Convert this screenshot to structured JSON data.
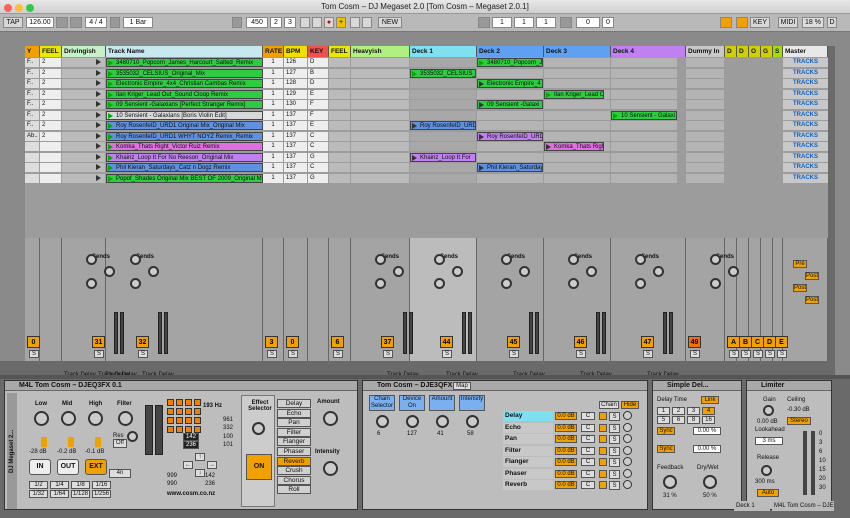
{
  "window": {
    "title": "Tom Cosm – DJ Megaset 2.0  [Tom Cosm – Megaset 2.0.1]"
  },
  "transport": {
    "tap": "TAP",
    "tempo": "126.00",
    "sig": "4 / 4",
    "quant": "1 Bar",
    "pos": "450",
    "pos_b": "2",
    "pos_c": "3",
    "new": "NEW",
    "loop_a": "1",
    "loop_b": "1",
    "loop_c": "1",
    "loop_d": "0",
    "loop_e": "0",
    "key": "KEY",
    "midi": "MIDI",
    "cpu": "18 %",
    "d_label": "D"
  },
  "colors": {
    "accent": "#f0a000",
    "green": "#2ecc40",
    "cyan": "#7ee0f0",
    "purple": "#c080f0",
    "blue": "#6090e0"
  },
  "tracks": [
    {
      "name": "Y",
      "bg": "#f0a000"
    },
    {
      "name": "FEEL",
      "bg": "#e8e800"
    },
    {
      "name": "Drivingish",
      "bg": "#c8f0c8"
    },
    {
      "name": "Track Name",
      "bg": "#c8e8f0"
    },
    {
      "name": "RATE",
      "bg": "#f0a000"
    },
    {
      "name": "BPM",
      "bg": "#f0e000"
    },
    {
      "name": "KEY",
      "bg": "#f05050"
    },
    {
      "name": "FEEL",
      "bg": "#e8e800"
    },
    {
      "name": "Heavyish",
      "bg": "#b0f080"
    },
    {
      "name": "Deck 1",
      "bg": "#7ee0f0"
    },
    {
      "name": "Deck 2",
      "bg": "#60a0f0"
    },
    {
      "name": "Deck 3",
      "bg": "#60a0f0"
    },
    {
      "name": "Deck 4",
      "bg": "#c080f0"
    },
    {
      "name": "Dummy In",
      "bg": "#c8c8c8"
    },
    {
      "name": "D",
      "bg": "#d0d000"
    },
    {
      "name": "D",
      "bg": "#d0d000"
    },
    {
      "name": "O",
      "bg": "#d0d000"
    },
    {
      "name": "G",
      "bg": "#d0d000"
    },
    {
      "name": "S",
      "bg": "#a0e000"
    },
    {
      "name": "Master",
      "bg": "#e8e8e8"
    }
  ],
  "rows": [
    {
      "l": "F..",
      "n": "2",
      "name": "3480710_Popcorn_James_Harcourt_Salted_Remix",
      "c": "#2ecc40",
      "r": "1",
      "b": "126",
      "k": "D"
    },
    {
      "l": "F..",
      "n": "2",
      "name": "3535032_CELSIUS_Original_Mix",
      "c": "#2ecc40",
      "r": "1",
      "b": "127",
      "k": "B"
    },
    {
      "l": "F..",
      "n": "2",
      "name": "Electronic Empire_4x4_Christian Cambas Remix",
      "c": "#2ecc40",
      "r": "1",
      "b": "128",
      "k": "D"
    },
    {
      "l": "F..",
      "n": "2",
      "name": "Ilan Kriger_Lead Out_Sound Cloop Remix",
      "c": "#2ecc40",
      "r": "1",
      "b": "129",
      "k": "E"
    },
    {
      "l": "F..",
      "n": "2",
      "name": "09 Sensient -Galaxians [Perfect Stranger Remix]",
      "c": "#2ecc40",
      "r": "1",
      "b": "130",
      "k": "F"
    },
    {
      "l": "F..",
      "n": "2",
      "name": "10 Sensient - Galaxians [Boris Violin Edit]",
      "c": "#d8d8d8",
      "r": "1",
      "b": "137",
      "k": "F"
    },
    {
      "l": "F..",
      "n": "2",
      "name": "Roy RosenfeID_URD1 Original Mix_Original Mix",
      "c": "#6090e0",
      "r": "1",
      "b": "137",
      "k": "E"
    },
    {
      "l": "Ab..",
      "n": "2",
      "name": "Roy RosenfeID_URD1 WHYT NOYZ Remix_Remix",
      "c": "#6090e0",
      "r": "1",
      "b": "137",
      "k": "C"
    },
    {
      "l": "",
      "n": "",
      "name": "Komka_Thats Right_Victor Ruiz Remix",
      "c": "#e070e0",
      "r": "1",
      "b": "137",
      "k": "C"
    },
    {
      "l": "",
      "n": "",
      "name": "Khainz_Loop It For No Reeson_Original Mix",
      "c": "#c080f0",
      "r": "1",
      "b": "137",
      "k": "G"
    },
    {
      "l": "",
      "n": "",
      "name": "Phil Kieran_Saturdays_Catz n Dogz Remix",
      "c": "#6090e0",
      "r": "1",
      "b": "137",
      "k": "C"
    },
    {
      "l": "",
      "n": "",
      "name": "Popof_Shades Original Mix BEST OF 2009_Original M",
      "c": "#2ecc40",
      "r": "1",
      "b": "137",
      "k": "G"
    }
  ],
  "decks": {
    "d1": [
      {
        "row": 1,
        "t": "3535032_CELSIUS_",
        "c": "#2ecc40",
        "p": true
      },
      {
        "row": 6,
        "t": "Roy RosenfeID_URD",
        "c": "#6090e0"
      },
      {
        "row": 9,
        "t": "Khainz_Loop It For",
        "c": "#c080f0"
      }
    ],
    "d2": [
      {
        "row": 0,
        "t": "3480710_Popcorn_J",
        "c": "#2ecc40",
        "p": true
      },
      {
        "row": 2,
        "t": "Electronic Empire_4",
        "c": "#2ecc40"
      },
      {
        "row": 4,
        "t": "09 Sensient -Galaxi",
        "c": "#2ecc40"
      },
      {
        "row": 7,
        "t": "Roy RosenfeID_URD",
        "c": "#c080f0"
      },
      {
        "row": 10,
        "t": "Phil Kieran_Saturday",
        "c": "#6090e0"
      }
    ],
    "d3": [
      {
        "row": 3,
        "t": "Ilan Kriger_Lead Out",
        "c": "#2ecc40",
        "p": true
      },
      {
        "row": 8,
        "t": "Komka_Thats Right",
        "c": "#e070e0"
      }
    ],
    "d4": [
      {
        "row": 5,
        "t": "10 Sensient - Galaxi",
        "c": "#2ecc40",
        "p": true
      }
    ]
  },
  "master_label": "TRACKS",
  "mixer": {
    "sends": "Sends",
    "track_delay": "Track Delay",
    "ms": "ms",
    "delay_val": "0.00",
    "a": "A",
    "b": "B",
    "s": "S",
    "numbers": [
      "0",
      "31",
      "32",
      "3",
      "0",
      "6",
      "37",
      "44",
      "45",
      "46",
      "47",
      "49",
      "A",
      "B",
      "C",
      "D",
      "E"
    ],
    "deck_pos": [
      "0:28",
      "1:55",
      "0:4",
      "0:54"
    ],
    "pre": "Pre",
    "post": "Post"
  },
  "devices": {
    "m4l": {
      "title": "M4L Tom Cosm – DJEQ3FX 0.1",
      "side": "DJ Megaset 2...",
      "low": "Low",
      "mid": "Mid",
      "high": "High",
      "filter": "Filter",
      "res": "Res",
      "low_db": "-28 dB",
      "mid_db": "-0.2 dB",
      "high_db": "-0.1 dB",
      "in": "IN",
      "out": "OUT",
      "ext": "EXT",
      "off": "Off",
      "n4": "4n",
      "beats": [
        "1/2",
        "1/4",
        "1/8",
        "1/16",
        "1/32",
        "1/64",
        "1/128",
        "1/256"
      ],
      "hz": "193 Hz",
      "nums": [
        "142",
        "236"
      ],
      "v1": "961",
      "v2": "332",
      "v3": "100",
      "v4": "101",
      "p1": "999",
      "p2": "990",
      "p3": "142",
      "p4": "236",
      "url": "www.cosm.co.nz",
      "effect_selector": "Effect Selector",
      "amount": "Amount",
      "intensity": "Intensity",
      "on": "ON",
      "fx": [
        "Delay",
        "Echo",
        "Pan",
        "Filter",
        "Flanger",
        "Phaser",
        "Reverb",
        "Crush",
        "Chorus",
        "Roll"
      ]
    },
    "eq3": {
      "title": "Tom Cosm – DJE3QFX",
      "map": "Map",
      "macros": [
        {
          "t": "Chain Selector",
          "v": "6"
        },
        {
          "t": "Device On",
          "v": "127"
        },
        {
          "t": "Amount",
          "v": "41"
        },
        {
          "t": "Intensity",
          "v": "58"
        }
      ],
      "chain": "Chain",
      "hide": "Hide",
      "chains": [
        {
          "n": "Delay",
          "v": "0.0 dB"
        },
        {
          "n": "Echo",
          "v": "0.0 dB"
        },
        {
          "n": "Pan",
          "v": "0.0 dB"
        },
        {
          "n": "Filter",
          "v": "0.0 dB"
        },
        {
          "n": "Flanger",
          "v": "0.0 dB"
        },
        {
          "n": "Phaser",
          "v": "0.0 dB"
        },
        {
          "n": "Reverb",
          "v": "0.0 dB"
        }
      ],
      "c": "C",
      "s": "S"
    },
    "simple_delay": {
      "title": "Simple Del...",
      "delay_time": "Delay Time",
      "link": "Link",
      "grid": [
        "1",
        "2",
        "3",
        "4",
        "5",
        "6",
        "8",
        "16"
      ],
      "sync": "Sync",
      "pct": "0.00 %",
      "feedback": "Feedback",
      "drywet": "Dry/Wet",
      "fb": "31 %",
      "dw": "50 %"
    },
    "limiter": {
      "title": "Limiter",
      "gain": "Gain",
      "ceiling": "Ceiling",
      "gain_v": "0.00 dB",
      "ceiling_v": "-0.30 dB",
      "stereo": "Stereo",
      "lookahead": "Lookahead",
      "la_v": "3 ms",
      "release": "Release",
      "rel_v": "300 ms",
      "auto": "Auto",
      "scale": [
        "0",
        "3",
        "6",
        "10",
        "15",
        "20",
        "30"
      ]
    },
    "bottom_left": "Deck 1",
    "bottom_right": "M4L Tom Cosm – DJEQ3FX 0.1"
  }
}
